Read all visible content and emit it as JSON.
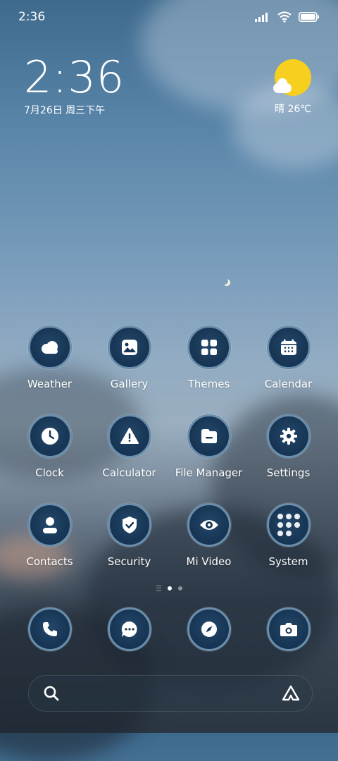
{
  "status_bar": {
    "time": "2:36"
  },
  "clock_widget": {
    "time": "2:36",
    "date": "7月26日 周三下午"
  },
  "weather_widget": {
    "text": "晴 26℃"
  },
  "apps": [
    {
      "label": "Weather",
      "icon": "weather-cloud-icon"
    },
    {
      "label": "Gallery",
      "icon": "gallery-icon"
    },
    {
      "label": "Themes",
      "icon": "themes-grid-icon"
    },
    {
      "label": "Calendar",
      "icon": "calendar-icon"
    },
    {
      "label": "Clock",
      "icon": "clock-icon"
    },
    {
      "label": "Calculator",
      "icon": "warning-triangle-icon"
    },
    {
      "label": "File Manager",
      "icon": "folder-icon"
    },
    {
      "label": "Settings",
      "icon": "gear-icon"
    },
    {
      "label": "Contacts",
      "icon": "person-icon"
    },
    {
      "label": "Security",
      "icon": "shield-check-icon"
    },
    {
      "label": "Mi Video",
      "icon": "eye-icon"
    },
    {
      "label": "System",
      "icon": "system-folder-icon"
    }
  ],
  "dock": [
    {
      "icon": "phone-icon"
    },
    {
      "icon": "message-icon"
    },
    {
      "icon": "compass-icon"
    },
    {
      "icon": "camera-icon"
    }
  ],
  "page_indicator": {
    "pages": 2,
    "current": 1
  },
  "colors": {
    "icon_bg": "#163453",
    "icon_ring": "#6a8eab",
    "sun": "#f7cf1e"
  }
}
